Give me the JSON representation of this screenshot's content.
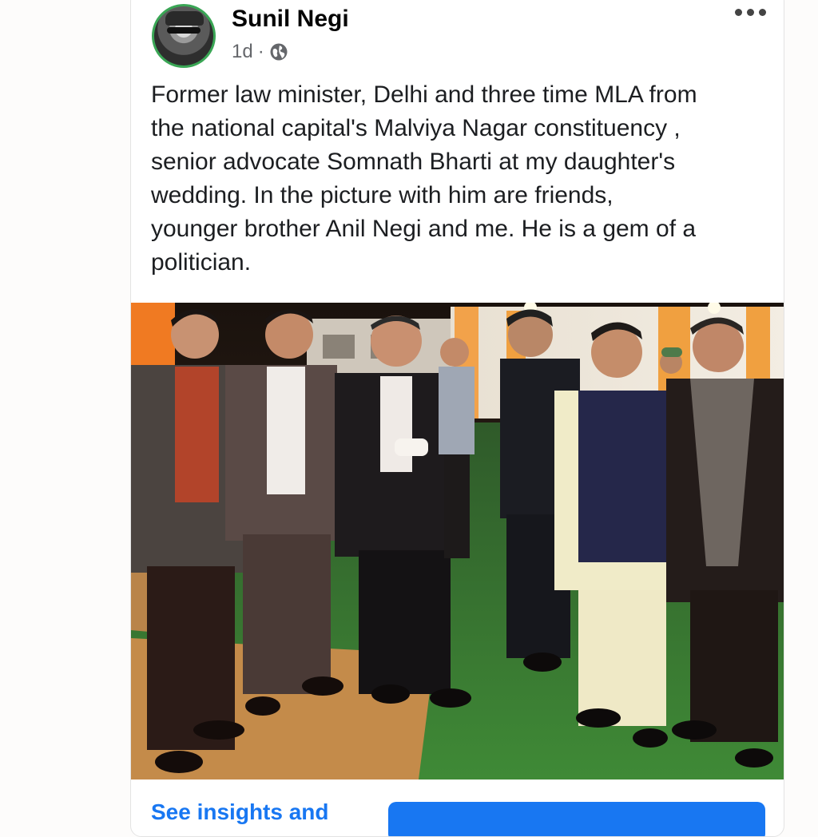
{
  "post": {
    "author": "Sunil Negi",
    "time": "1d",
    "privacy_icon": "globe-icon",
    "more_icon": "more-options-icon",
    "text": "Former law minister, Delhi and three time MLA from\nthe national capital's Malviya Nagar constituency ,\nsenior advocate Somnath Bharti at my  daughter's\nwedding. In the picture with him are friends,\nyounger brother Anil Negi and me. He is a gem of a\npolitician.",
    "photo_alt": "Group photo of six men at an outdoor wedding venue at night"
  },
  "footer": {
    "insights_link": "See insights and"
  },
  "colors": {
    "accent": "#1877f2",
    "avatar_ring": "#3aa655",
    "secondary_text": "#65676b"
  }
}
